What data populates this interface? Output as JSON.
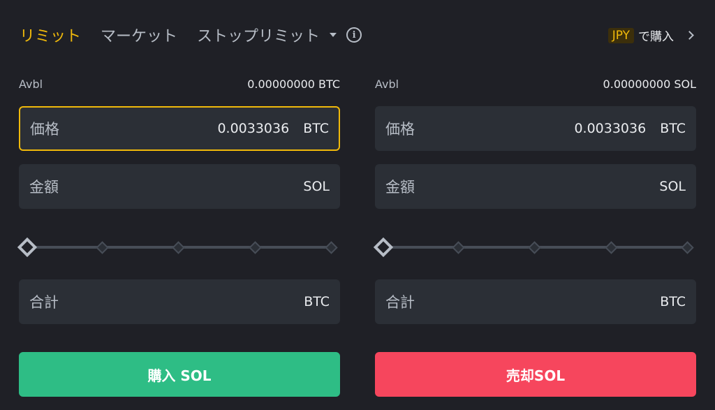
{
  "tabs": [
    {
      "label": "リミット",
      "active": true
    },
    {
      "label": "マーケット",
      "active": false
    },
    {
      "label": "ストップリミット",
      "active": false
    }
  ],
  "buy_with": {
    "currency": "JPY",
    "label": "で購入"
  },
  "buy": {
    "avbl_label": "Avbl",
    "avbl_value": "0.00000000 BTC",
    "price_label": "価格",
    "price_value": "0.0033036",
    "price_unit": "BTC",
    "amount_label": "金額",
    "amount_unit": "SOL",
    "total_label": "合計",
    "total_unit": "BTC",
    "button_label": "購入 SOL",
    "slider_percent": 0
  },
  "sell": {
    "avbl_label": "Avbl",
    "avbl_value": "0.00000000 SOL",
    "price_label": "価格",
    "price_value": "0.0033036",
    "price_unit": "BTC",
    "amount_label": "金額",
    "amount_unit": "SOL",
    "total_label": "合計",
    "total_unit": "BTC",
    "button_label": "売却SOL",
    "slider_percent": 0
  },
  "colors": {
    "accent": "#f0b90b",
    "buy": "#2ebd85",
    "sell": "#f6465d",
    "background": "#1f2026",
    "field": "#2b2f36"
  }
}
